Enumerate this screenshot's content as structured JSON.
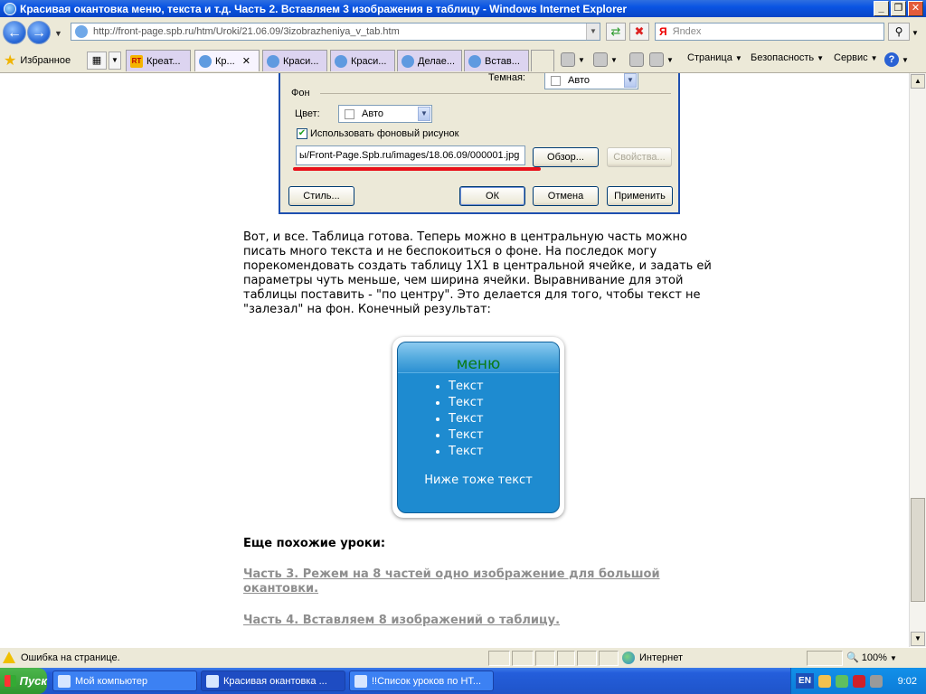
{
  "window": {
    "title": "Красивая окантовка меню, текста и т.д. Часть 2. Вставляем 3 изображения в таблицу - Windows Internet Explorer",
    "minimize": "_",
    "maximize": "❐",
    "close": "✕"
  },
  "address": {
    "url": "http://front-page.spb.ru/htm/Uroki/21.06.09/3izobrazheniya_v_tab.htm",
    "search_placeholder": "Яndex",
    "search_logo": "Я"
  },
  "toolbar": {
    "favorites": "Избранное",
    "tabs": [
      {
        "label": "Креат...",
        "icon": "rt-icon"
      },
      {
        "label": "Кр...",
        "icon": "ie-page-icon",
        "active": true,
        "close": "✕"
      },
      {
        "label": "Краси...",
        "icon": "ie-page-icon"
      },
      {
        "label": "Краси...",
        "icon": "ie-page-icon"
      },
      {
        "label": "Делае...",
        "icon": "ie-page-icon"
      },
      {
        "label": "Встав...",
        "icon": "ie-page-icon"
      }
    ],
    "page_menu": "Страница",
    "safety_menu": "Безопасность",
    "service_menu": "Сервис",
    "help": "?"
  },
  "dialog": {
    "dark_label": "Темная:",
    "dark_value": "Авто",
    "background_section": "Фон",
    "color_label": "Цвет:",
    "color_value": "Авто",
    "use_bg_image": "Использовать фоновый рисунок",
    "bg_path": "ы/Front-Page.Spb.ru/images/18.06.09/000001.jpg",
    "browse_button": "Обзор...",
    "properties_button": "Свойства...",
    "style_button": "Стиль...",
    "ok_button": "ОК",
    "cancel_button": "Отмена",
    "apply_button": "Применить"
  },
  "article": {
    "paragraph": "Вот, и все. Таблица готова. Теперь можно в центральную часть можно писать много текста и не беспокоиться о фоне. На последок могу порекомендовать создать таблицу 1X1 в центральной ячейке, и задать ей параметры чуть меньше, чем ширина ячейки. Выравнивание для этой таблицы поставить - \"по центру\". Это делается для того, чтобы текст не \"залезал\" на фон. Конечный результат:",
    "demo": {
      "menu_title": "меню",
      "items": [
        "Текст",
        "Текст",
        "Текст",
        "Текст",
        "Текст"
      ],
      "below_text": "Ниже тоже текст"
    },
    "similar_heading": "Еще похожие уроки:",
    "links": [
      "Часть 3. Режем на 8 частей одно изображение для большой окантовки.",
      "Часть 4. Вставляем 8 изображений о таблицу."
    ]
  },
  "status": {
    "error_text": "Ошибка на странице.",
    "zone": "Интернет",
    "zoom": "100%"
  },
  "taskbar": {
    "start": "Пуск",
    "tasks": [
      {
        "label": "Мой компьютер"
      },
      {
        "label": "Красивая окантовка ...",
        "active": true
      },
      {
        "label": "!!Список уроков по НТ..."
      }
    ],
    "lang": "EN",
    "clock": "9:02"
  },
  "colors": {
    "titlebar": "#0a54e3",
    "demo_panel": "#1e8bd0",
    "demo_menu_text": "#0a7a16",
    "link_gray": "#8e8e8e",
    "annotation_red": "#e8121b"
  }
}
